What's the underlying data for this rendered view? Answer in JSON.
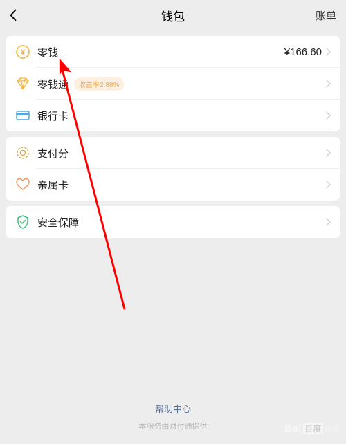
{
  "header": {
    "title": "钱包",
    "right_label": "账单"
  },
  "section1": {
    "items": [
      {
        "label": "零钱",
        "value": "¥166.60"
      },
      {
        "label": "零钱通",
        "badge": "收益率2.88%"
      },
      {
        "label": "银行卡"
      }
    ]
  },
  "section2": {
    "items": [
      {
        "label": "支付分"
      },
      {
        "label": "亲属卡"
      }
    ]
  },
  "section3": {
    "items": [
      {
        "label": "安全保障"
      }
    ]
  },
  "footer": {
    "link": "帮助中心",
    "desc": "本服务由财付通提供"
  }
}
